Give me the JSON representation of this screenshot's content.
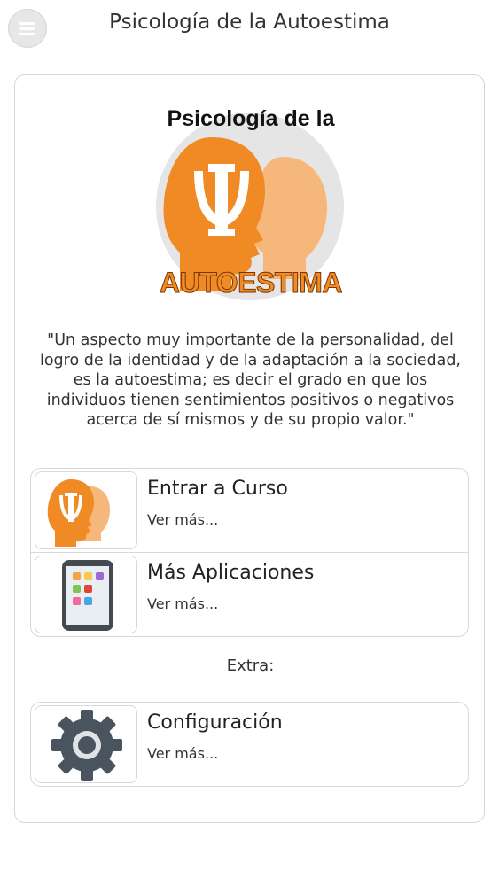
{
  "header": {
    "title": "Psicología de la Autoestima",
    "menu_icon": "hamburger-menu-icon"
  },
  "logo": {
    "top_text": "Psicología de la",
    "bottom_text": "AUTOESTIMA",
    "colors": {
      "orange": "#f08a25",
      "light_orange": "#f6b77a",
      "circle": "#e5e5e5"
    }
  },
  "quote": "\"Un aspecto muy importante de la personalidad, del logro de la identidad y de la adaptación a la sociedad, es la autoestima; es decir el grado en que los individuos tienen sentimientos positivos o negativos acerca de sí mismos y de su propio valor.\"",
  "menu_items": [
    {
      "title": "Entrar a Curso",
      "subtitle": "Ver más...",
      "icon": "psi-heads-icon"
    },
    {
      "title": "Más Aplicaciones",
      "subtitle": "Ver más...",
      "icon": "tablet-apps-icon"
    }
  ],
  "extra_label": "Extra:",
  "extra_items": [
    {
      "title": "Configuración",
      "subtitle": "Ver más...",
      "icon": "gear-icon"
    }
  ]
}
